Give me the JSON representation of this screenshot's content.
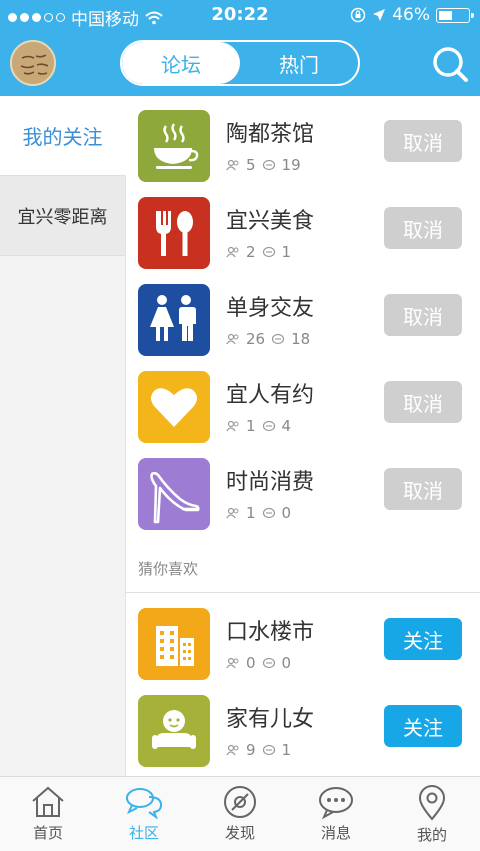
{
  "status_bar": {
    "carrier": "中国移动",
    "time": "20:22",
    "battery": "46%"
  },
  "header": {
    "tabs": [
      {
        "label": "论坛",
        "active": true
      },
      {
        "label": "热门",
        "active": false
      }
    ],
    "search_icon": "search-icon",
    "accent_color": "#3cb1ea"
  },
  "sidebar": {
    "items": [
      {
        "label": "我的关注",
        "active": true
      },
      {
        "label": "宜兴零距离",
        "active": false
      }
    ]
  },
  "following": [
    {
      "name": "陶都茶馆",
      "members": "5",
      "posts": "19",
      "icon": "teacup-icon",
      "action": "取消"
    },
    {
      "name": "宜兴美食",
      "members": "2",
      "posts": "1",
      "icon": "fork-spoon-icon",
      "action": "取消"
    },
    {
      "name": "单身交友",
      "members": "26",
      "posts": "18",
      "icon": "couple-icon",
      "action": "取消"
    },
    {
      "name": "宜人有约",
      "members": "1",
      "posts": "4",
      "icon": "heart-icon",
      "action": "取消"
    },
    {
      "name": "时尚消费",
      "members": "1",
      "posts": "0",
      "icon": "high-heel-icon",
      "action": "取消"
    }
  ],
  "recommend_label": "猜你喜欢",
  "recommend": [
    {
      "name": "口水楼市",
      "members": "0",
      "posts": "0",
      "icon": "building-icon",
      "action": "关注"
    },
    {
      "name": "家有儿女",
      "members": "9",
      "posts": "1",
      "icon": "baby-icon",
      "action": "关注"
    }
  ],
  "tabbar": {
    "items": [
      {
        "label": "首页",
        "icon": "home-icon",
        "active": false
      },
      {
        "label": "社区",
        "icon": "chat-bubbles-icon",
        "active": true
      },
      {
        "label": "发现",
        "icon": "compass-icon",
        "active": false
      },
      {
        "label": "消息",
        "icon": "message-icon",
        "active": false
      },
      {
        "label": "我的",
        "icon": "location-pin-icon",
        "active": false
      }
    ]
  }
}
